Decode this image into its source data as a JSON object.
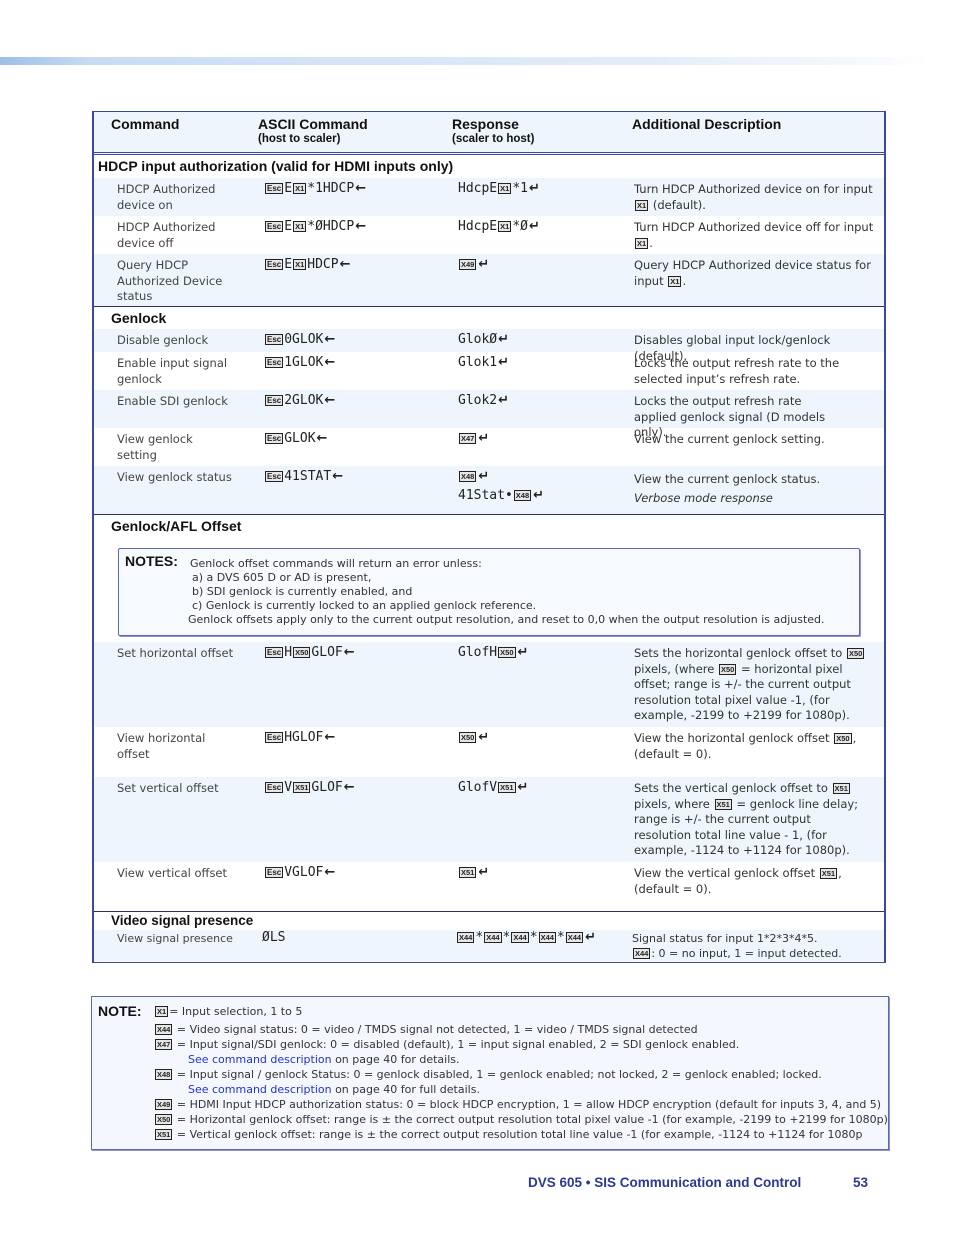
{
  "header": {
    "col_command": "Command",
    "col_ascii": "ASCII Command",
    "col_ascii_sub": "(host to scaler)",
    "col_response": "Response",
    "col_response_sub": "(scaler to host)",
    "col_description": "Additional Description"
  },
  "icons": {
    "esc_key": "Esc",
    "enter_arrow": "←",
    "return_arrow": "↵"
  },
  "sections": {
    "hdcp": {
      "title": "HDCP input authorization (valid for HDMI inputs only)",
      "rows": [
        {
          "command": "HDCP Authorized device on",
          "ascii_pre": "E",
          "ascii_var": "X1",
          "ascii_post": "*1HDCP",
          "response_pre": "HdcpE",
          "response_var": "X1",
          "response_post": "*1",
          "desc_pre": "Turn HDCP Authorized device on for input",
          "desc_var": "X1",
          "desc_post": "(default)."
        },
        {
          "command": "HDCP Authorized device off",
          "ascii_pre": "E",
          "ascii_var": "X1",
          "ascii_post": "*ØHDCP",
          "response_pre": "HdcpE",
          "response_var": "X1",
          "response_post": "*Ø",
          "desc_pre": "Turn HDCP Authorized device off for input",
          "desc_var": "X1",
          "desc_post": "."
        },
        {
          "command": "Query HDCP Authorized Device status",
          "ascii_pre": "E",
          "ascii_var": "X1",
          "ascii_post": "HDCP",
          "response_var": "X49",
          "desc_pre": "Query HDCP Authorized device status for input",
          "desc_var": "X1",
          "desc_post": "."
        }
      ]
    },
    "genlock": {
      "title": "Genlock",
      "rows": [
        {
          "command": "Disable genlock",
          "ascii": "0GLOK",
          "response": "GlokØ",
          "desc": "Disables global input lock/genlock (default)."
        },
        {
          "command": "Enable input signal genlock",
          "ascii": "1GLOK",
          "response": "Glok1",
          "desc": "Locks the output refresh rate to the selected input’s refresh rate."
        },
        {
          "command": "Enable SDI genlock",
          "ascii": "2GLOK",
          "response": "Glok2",
          "desc": "Locks the output refresh rate applied genlock signal (D models only)."
        },
        {
          "command": "View genlock setting",
          "ascii": "GLOK",
          "response_var": "X47",
          "desc": "View the current genlock setting."
        },
        {
          "command": "View genlock status",
          "ascii": "41STAT",
          "response_var": "X48",
          "response2_pre": "41Stat•",
          "response2_var": "X48",
          "desc": "View the current genlock status.",
          "desc2": "Verbose mode response"
        }
      ]
    },
    "offset": {
      "title": "Genlock/AFL Offset",
      "notes_label": "NOTES:",
      "notes_lines": [
        "Genlock offset commands will return an error unless:",
        "a) a DVS 605 D or AD is present,",
        "b) SDI genlock is currently enabled, and",
        "c) Genlock is currently locked to an applied genlock reference.",
        "Genlock offsets apply only to the current output resolution, and reset to 0,0 when the output resolution is adjusted."
      ],
      "rows": [
        {
          "command": "Set horizontal offset",
          "ascii_pre": "H",
          "ascii_var": "X50",
          "ascii_post": "GLOF",
          "response_pre": "GlofH",
          "response_var": "X50",
          "desc_a": "Sets the horizontal genlock offset to",
          "desc_var": "X50",
          "desc_b": "pixels, (where",
          "desc_c": "= horizontal pixel offset; range is +/- the current output resolution total pixel value -1, (for example, -2199 to +2199 for 1080p)."
        },
        {
          "command": "View horizontal offset",
          "ascii": "HGLOF",
          "response_var": "X50",
          "desc_a": "View the horizontal genlock offset",
          "desc_var": "X50",
          "desc_c": ", (default = 0)."
        },
        {
          "command": "Set vertical offset",
          "ascii_pre": "V",
          "ascii_var": "X51",
          "ascii_post": "GLOF",
          "response_pre": "GlofV",
          "response_var": "X51",
          "desc_a": "Sets the vertical genlock offset to",
          "desc_var": "X51",
          "desc_b": "pixels, where",
          "desc_c": "= genlock line delay; range is +/- the current output resolution total line value - 1, (for example, -1124 to +1124 for 1080p)."
        },
        {
          "command": "View vertical offset",
          "ascii": "VGLOF",
          "response_var": "X51",
          "desc_a": "View the vertical genlock offset",
          "desc_var": "X51",
          "desc_c": ", (default = 0)."
        }
      ]
    },
    "video": {
      "title": "Video signal presence",
      "rows": [
        {
          "command": "View signal presence",
          "ascii": "ØLS",
          "response_var": "X44",
          "response_sep": "*",
          "desc": "Signal status for input 1*2*3*4*5.",
          "desc_var": "X44",
          "desc2": ": 0 = no input, 1 = input detected."
        }
      ]
    }
  },
  "note": {
    "label": "NOTE:",
    "items": [
      {
        "var": "X1",
        "text": "= Input selection, 1 to 5"
      },
      {
        "var": "X44",
        "text": " = Video signal status: 0 = video / TMDS signal not detected, 1 = video / TMDS signal detected"
      },
      {
        "var": "X47",
        "text": " = Input signal/SDI genlock: 0 = disabled (default), 1 = input signal enabled, 2 = SDI genlock enabled."
      },
      {
        "link": "See command description",
        "text": " on page 40 for details."
      },
      {
        "var": "X48",
        "text": " = Input signal / genlock Status: 0 = genlock disabled, 1 =  genlock enabled; not locked, 2 = genlock enabled; locked."
      },
      {
        "link": "See command description",
        "text": " on page 40 for full details."
      },
      {
        "var": "X49",
        "text": " = HDMI Input HDCP authorization status: 0 = block HDCP encryption, 1 = allow HDCP encryption (default for inputs 3, 4, and 5)"
      },
      {
        "var": "X50",
        "text": " = Horizontal genlock offset: range is ± the correct output resolution total pixel value -1 (for example, -2199 to +2199 for 1080p)"
      },
      {
        "var": "X51",
        "text": " = Vertical  genlock offset: range is ± the correct output resolution total line value -1 (for example, -1124 to +1124 for 1080p"
      }
    ]
  },
  "footer": {
    "title": "DVS 605 • SIS Communication and Control",
    "page": "53"
  },
  "colors": {
    "accent": "#2b3990",
    "row_shade": "#eef5fc",
    "link": "#2233cc"
  }
}
